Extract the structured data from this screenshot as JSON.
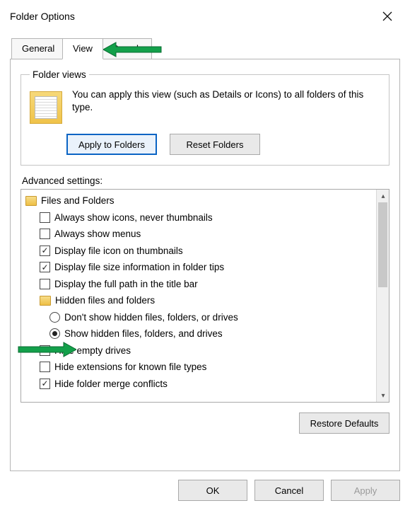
{
  "window": {
    "title": "Folder Options"
  },
  "tabs": {
    "general": "General",
    "view": "View",
    "search": "Search"
  },
  "folder_views": {
    "legend": "Folder views",
    "description": "You can apply this view (such as Details or Icons) to all folders of this type.",
    "apply_btn": "Apply to Folders",
    "reset_btn": "Reset Folders"
  },
  "advanced": {
    "label": "Advanced settings:",
    "items": [
      {
        "kind": "folder",
        "level": 0,
        "text": "Files and Folders"
      },
      {
        "kind": "check",
        "level": 1,
        "checked": false,
        "text": "Always show icons, never thumbnails"
      },
      {
        "kind": "check",
        "level": 1,
        "checked": false,
        "text": "Always show menus"
      },
      {
        "kind": "check",
        "level": 1,
        "checked": true,
        "text": "Display file icon on thumbnails"
      },
      {
        "kind": "check",
        "level": 1,
        "checked": true,
        "text": "Display file size information in folder tips"
      },
      {
        "kind": "check",
        "level": 1,
        "checked": false,
        "text": "Display the full path in the title bar"
      },
      {
        "kind": "folder",
        "level": 1,
        "text": "Hidden files and folders"
      },
      {
        "kind": "radio",
        "level": 2,
        "checked": false,
        "text": "Don't show hidden files, folders, or drives"
      },
      {
        "kind": "radio",
        "level": 2,
        "checked": true,
        "text": "Show hidden files, folders, and drives"
      },
      {
        "kind": "check",
        "level": 1,
        "checked": true,
        "text": "Hide empty drives"
      },
      {
        "kind": "check",
        "level": 1,
        "checked": false,
        "text": "Hide extensions for known file types"
      },
      {
        "kind": "check",
        "level": 1,
        "checked": true,
        "text": "Hide folder merge conflicts"
      }
    ],
    "restore_btn": "Restore Defaults"
  },
  "dialog_buttons": {
    "ok": "OK",
    "cancel": "Cancel",
    "apply": "Apply"
  }
}
